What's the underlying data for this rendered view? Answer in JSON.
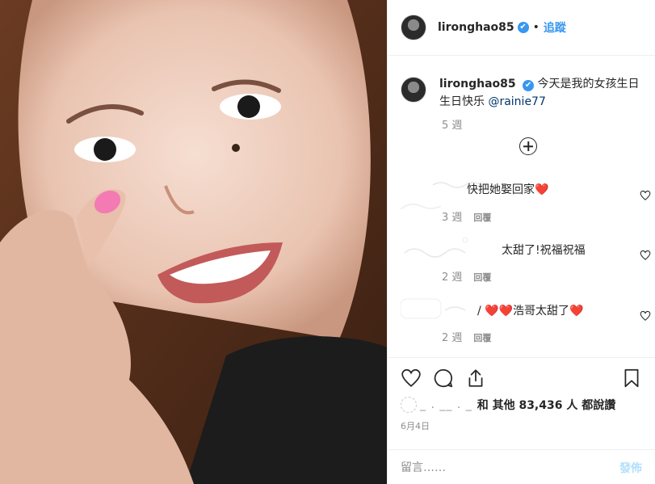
{
  "header": {
    "username": "lironghao85",
    "verified_mark": "✔",
    "separator": "•",
    "follow_label": "追蹤"
  },
  "caption": {
    "username": "lironghao85",
    "text": "今天是我的女孩生日 生日快乐",
    "mention": "@rainie77",
    "time": "5 週"
  },
  "comments": [
    {
      "text": "快把她娶回家❤️",
      "time": "3 週",
      "reply_label": "回覆"
    },
    {
      "text": "太甜了!祝福祝福",
      "time": "2 週",
      "reply_label": "回覆"
    },
    {
      "text": "/ ❤️❤️浩哥太甜了❤️",
      "time": "2 週",
      "reply_label": "回覆"
    }
  ],
  "likes": {
    "blurred_name": "_ . __ . _",
    "text": "和 其他 83,436 人 都說讚"
  },
  "date": "6月4日",
  "composer": {
    "placeholder": "留言……",
    "post_label": "發佈"
  },
  "icons": {
    "like": "heart-icon",
    "comment": "comment-icon",
    "share": "share-icon",
    "save": "bookmark-icon",
    "load_more": "plus-circle-icon"
  },
  "colors": {
    "link": "#3897f0",
    "post_disabled": "#b2dffc",
    "muted": "#8e8e8e"
  }
}
